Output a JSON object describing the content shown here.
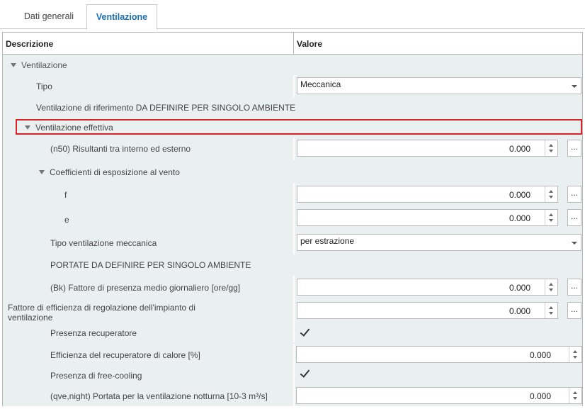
{
  "tabs": [
    {
      "label": "Dati generali",
      "active": false
    },
    {
      "label": "Ventilazione",
      "active": true
    }
  ],
  "grid": {
    "header": {
      "description": "Descrizione",
      "value": "Valore"
    },
    "rows": {
      "ventilazione": {
        "label": "Ventilazione"
      },
      "tipo": {
        "label": "Tipo",
        "value": "Meccanica"
      },
      "ventilazione_riferimento": {
        "label": "Ventilazione di riferimento DA DEFINIRE PER SINGOLO AMBIENTE"
      },
      "ventilazione_effettiva": {
        "label": "Ventilazione effettiva"
      },
      "n50": {
        "label": "(n50) Risultanti tra interno ed esterno",
        "value": "0.000"
      },
      "coefficienti": {
        "label": "Coefficienti di esposizione al vento"
      },
      "f": {
        "label": "f",
        "value": "0.000"
      },
      "e": {
        "label": "e",
        "value": "0.000"
      },
      "tipo_meccanica": {
        "label": "Tipo ventilazione meccanica",
        "value": "per estrazione"
      },
      "portate": {
        "label": "PORTATE DA DEFINIRE PER SINGOLO AMBIENTE"
      },
      "bk": {
        "label": "(Bk) Fattore di presenza medio giornaliero [ore/gg]",
        "value": "0.000"
      },
      "fattore_efficienza": {
        "label_line1": "Fattore di efficienza di regolazione dell'impianto di",
        "label_line2": "ventilazione",
        "value": "0.000"
      },
      "presenza_recuperatore": {
        "label": "Presenza recuperatore",
        "checked": true
      },
      "efficienza_recuperatore": {
        "label": "Efficienza del recuperatore di calore [%]",
        "value": "0.000"
      },
      "free_cooling": {
        "label": "Presenza di free-cooling",
        "checked": true
      },
      "qve_night": {
        "label": "(qve,night) Portata per la ventilazione notturna [10-3 m³/s]",
        "value": "0.000"
      }
    },
    "ellipsis_label": "..."
  },
  "colors": {
    "accent": "#1a6fb0",
    "row_background": "#eaf0f0",
    "highlight": "#d9242c"
  }
}
